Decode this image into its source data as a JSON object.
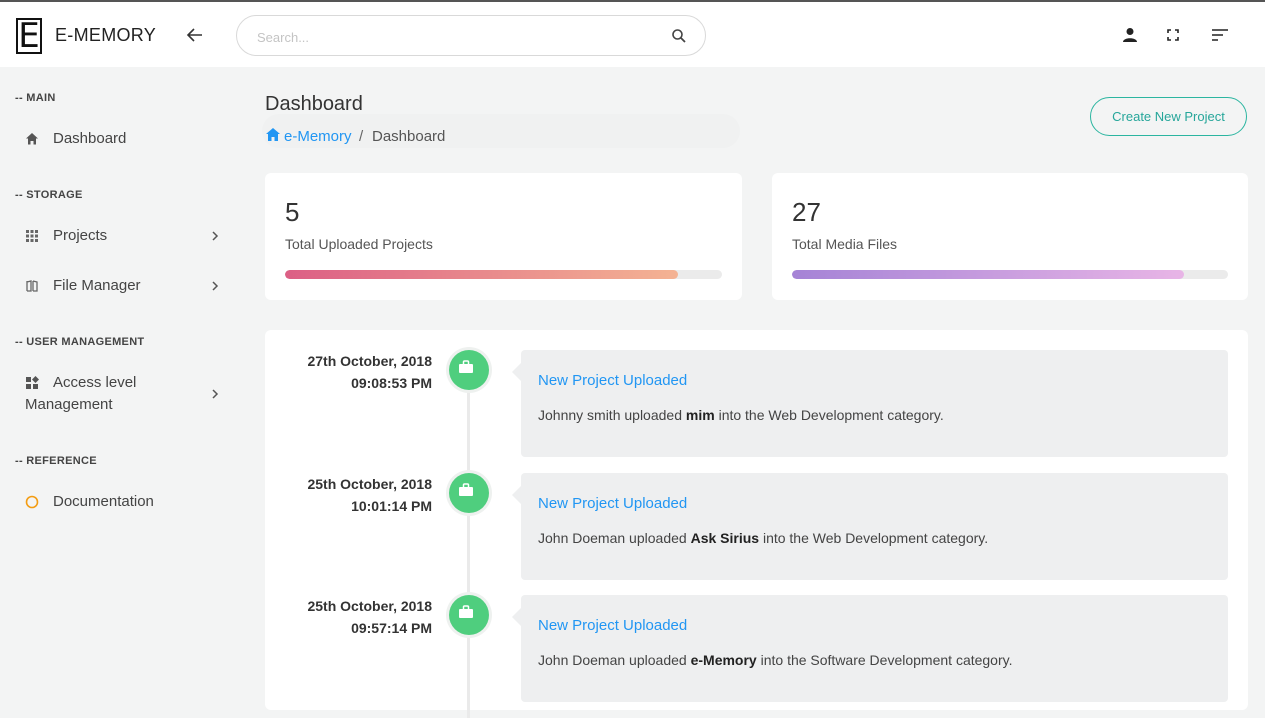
{
  "header": {
    "logo_letter": "E",
    "brand": "E-MEMORY",
    "search_placeholder": "Search..."
  },
  "sidebar": {
    "sections": [
      {
        "heading": "-- MAIN",
        "items": [
          {
            "label": "Dashboard",
            "icon": "home-icon",
            "has_chevron": false
          }
        ]
      },
      {
        "heading": "-- STORAGE",
        "items": [
          {
            "label": "Projects",
            "icon": "grid-icon",
            "has_chevron": true
          },
          {
            "label": "File Manager",
            "icon": "file-manager-icon",
            "has_chevron": true
          }
        ]
      },
      {
        "heading": "-- USER MANAGEMENT",
        "items": [
          {
            "label_line1": "Access level",
            "label_line2": "Management",
            "icon": "widgets-icon",
            "has_chevron": true
          }
        ]
      },
      {
        "heading": "-- REFERENCE",
        "items": [
          {
            "label": "Documentation",
            "icon": "circle-icon",
            "has_chevron": false
          }
        ]
      }
    ]
  },
  "main": {
    "title": "Dashboard",
    "breadcrumb": {
      "home": "e-Memory",
      "separator": "/",
      "current": "Dashboard"
    },
    "create_button": "Create New Project",
    "stats": [
      {
        "value": "5",
        "label": "Total Uploaded Projects",
        "progress": 0.9,
        "gradient": [
          "#dc5f85",
          "#f4b393"
        ]
      },
      {
        "value": "27",
        "label": "Total Media Files",
        "progress": 0.9,
        "gradient": [
          "#a583d6",
          "#e8b5e6"
        ]
      }
    ],
    "timeline": [
      {
        "date": "27th October, 2018",
        "time": "09:08:53 PM",
        "title": "New Project Uploaded",
        "user": "Johnny smith",
        "verb": " uploaded ",
        "project": "mim",
        "suffix": " into the Web Development category."
      },
      {
        "date": "25th October, 2018",
        "time": "10:01:14 PM",
        "title": "New Project Uploaded",
        "user": "John Doeman",
        "verb": " uploaded ",
        "project": "Ask Sirius",
        "suffix": " into the Web Development category."
      },
      {
        "date": "25th October, 2018",
        "time": "09:57:14 PM",
        "title": "New Project Uploaded",
        "user": "John Doeman",
        "verb": " uploaded ",
        "project": "e-Memory",
        "suffix": " into the Software Development category."
      }
    ],
    "accent_color": "#2196f3",
    "timeline_dot_color": "#4fce7e"
  }
}
